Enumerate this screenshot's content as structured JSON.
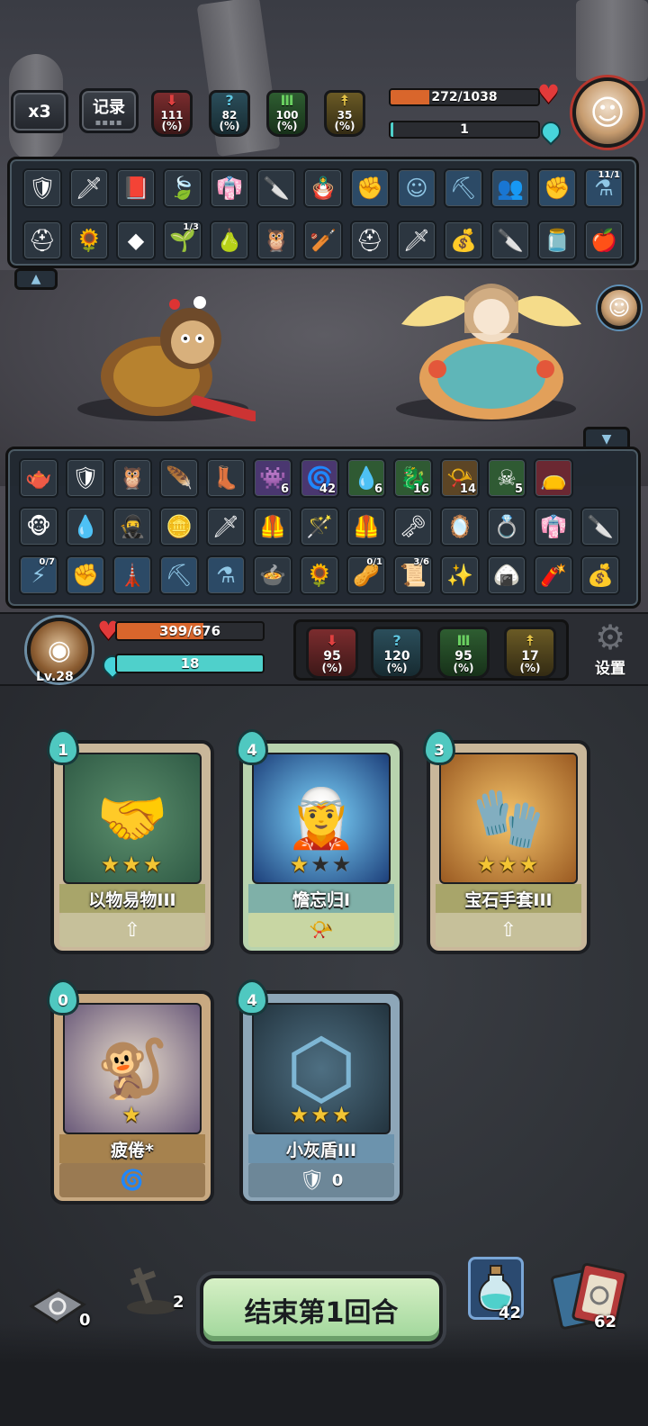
{
  "top_bar": {
    "speed_label": "x3",
    "record_label": "记录",
    "enemy_stats": [
      {
        "name": "attack",
        "value": "111",
        "unit": "(%)",
        "color": "#e04040"
      },
      {
        "name": "magic",
        "value": "82",
        "unit": "(%)",
        "color": "#5fc6e0"
      },
      {
        "name": "defense",
        "value": "100",
        "unit": "(%)",
        "color": "#6ad061"
      },
      {
        "name": "luck",
        "value": "35",
        "unit": "(%)",
        "color": "#e5c447"
      }
    ],
    "enemy_hp": {
      "text": "272/1038",
      "fraction": 0.262
    },
    "enemy_energy": {
      "text": "1",
      "fraction": 0.02
    }
  },
  "enemy_items_row1": [
    {
      "icon": "shield"
    },
    {
      "icon": "sword"
    },
    {
      "icon": "book"
    },
    {
      "icon": "leaf-blade"
    },
    {
      "icon": "cloak"
    },
    {
      "icon": "dagger"
    },
    {
      "icon": "doll"
    },
    {
      "icon": "fist-skill"
    },
    {
      "icon": "head-skill"
    },
    {
      "icon": "pickaxe-skill"
    },
    {
      "icon": "figures-skill"
    },
    {
      "icon": "punch-skill"
    },
    {
      "icon": "bottle-skill",
      "frac": "11/1"
    }
  ],
  "enemy_items_row2": [
    {
      "icon": "helmet"
    },
    {
      "icon": "flower"
    },
    {
      "icon": "green-gem"
    },
    {
      "icon": "peashooter",
      "frac": "1/3"
    },
    {
      "icon": "gourd"
    },
    {
      "icon": "owl"
    },
    {
      "icon": "club"
    },
    {
      "icon": "iron-helmet"
    },
    {
      "icon": "golden-sword"
    },
    {
      "icon": "bag"
    },
    {
      "icon": "kunai"
    },
    {
      "icon": "slime-jar"
    },
    {
      "icon": "fire-apple"
    }
  ],
  "player_items_row1": [
    {
      "icon": "teapot"
    },
    {
      "icon": "shield"
    },
    {
      "icon": "owl"
    },
    {
      "icon": "wing"
    },
    {
      "icon": "boot"
    },
    {
      "icon": "purple-monster",
      "count": "6"
    },
    {
      "icon": "spiral",
      "count": "42"
    },
    {
      "icon": "poison-drop",
      "count": "6"
    },
    {
      "icon": "green-dragon",
      "count": "16"
    },
    {
      "icon": "horn",
      "count": "14"
    },
    {
      "icon": "skull",
      "count": "5"
    },
    {
      "icon": "red-bag"
    }
  ],
  "player_items_row2": [
    {
      "icon": "monkey-head"
    },
    {
      "icon": "water-orb"
    },
    {
      "icon": "bandit"
    },
    {
      "icon": "gold-ingot"
    },
    {
      "icon": "golden-sword"
    },
    {
      "icon": "armor"
    },
    {
      "icon": "staff"
    },
    {
      "icon": "armor-2"
    },
    {
      "icon": "key-sword"
    },
    {
      "icon": "mirror"
    },
    {
      "icon": "ring"
    },
    {
      "icon": "cloak"
    },
    {
      "icon": "kunai"
    }
  ],
  "player_items_row3": [
    {
      "icon": "lightning-skill",
      "frac": "0/7"
    },
    {
      "icon": "punch-skill"
    },
    {
      "icon": "tower-skill"
    },
    {
      "icon": "pickaxe-skill"
    },
    {
      "icon": "bottle-skill"
    },
    {
      "icon": "pot"
    },
    {
      "icon": "flower"
    },
    {
      "icon": "peanut",
      "frac": "0/1"
    },
    {
      "icon": "scroll",
      "frac": "3/6"
    },
    {
      "icon": "spark-orb"
    },
    {
      "icon": "rice-ball"
    },
    {
      "icon": "red-stick"
    },
    {
      "icon": "bag"
    }
  ],
  "player": {
    "level": "Lv.28",
    "hp": {
      "text": "399/676",
      "fraction": 0.59
    },
    "energy": {
      "text": "18",
      "fraction": 1.0
    },
    "stats": [
      {
        "name": "attack",
        "value": "95",
        "unit": "(%)"
      },
      {
        "name": "magic",
        "value": "120",
        "unit": "(%)"
      },
      {
        "name": "defense",
        "value": "95",
        "unit": "(%)"
      },
      {
        "name": "luck",
        "value": "17",
        "unit": "(%)"
      }
    ],
    "settings_label": "设置"
  },
  "hand_cards": [
    {
      "cost": "1",
      "name": "以物易物III",
      "stars": 3,
      "foot_icon": "up-arrow",
      "foot_value": "",
      "theme": "tan",
      "art": "handshake"
    },
    {
      "cost": "4",
      "name": "憺忘归I",
      "stars": 1,
      "foot_icon": "whistle",
      "foot_value": "",
      "theme": "green",
      "art": "girl"
    },
    {
      "cost": "3",
      "name": "宝石手套III",
      "stars": 3,
      "foot_icon": "up-arrow",
      "foot_value": "",
      "theme": "tan",
      "art": "gauntlet"
    },
    {
      "cost": "0",
      "name": "疲倦*",
      "stars": 1,
      "foot_icon": "spiral",
      "foot_value": "",
      "theme": "brown",
      "art": "tired"
    },
    {
      "cost": "4",
      "name": "小灰盾III",
      "stars": 3,
      "foot_icon": "shield",
      "foot_value": "0",
      "theme": "blue",
      "art": "shield"
    }
  ],
  "bottom": {
    "discard_count": "0",
    "grave_count": "2",
    "end_turn_label": "结束第1回合",
    "potion_count": "42",
    "deck_count": "62"
  }
}
